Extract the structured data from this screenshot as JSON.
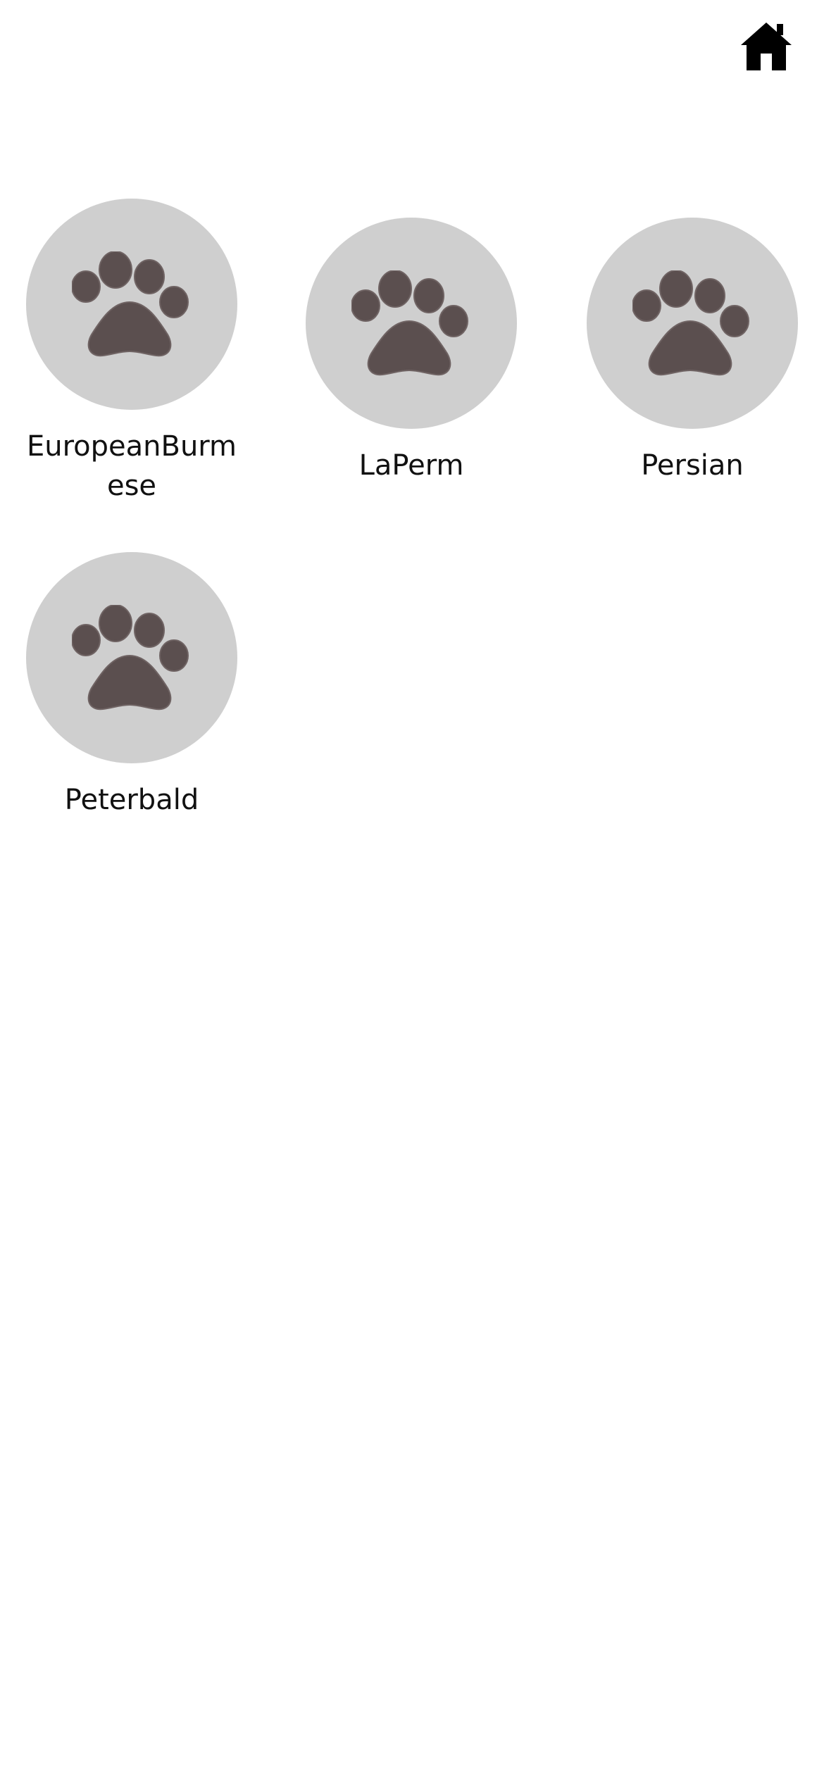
{
  "header": {
    "home_icon": "home-icon"
  },
  "colors": {
    "background": "#ffffff",
    "avatar_background": "#cfcfcf",
    "paw_color": "#5b4f4f",
    "text": "#111111"
  },
  "breeds": [
    {
      "name": "EuropeanBurmese",
      "icon": "paw-icon"
    },
    {
      "name": "LaPerm",
      "icon": "paw-icon"
    },
    {
      "name": "Persian",
      "icon": "paw-icon"
    },
    {
      "name": "Peterbald",
      "icon": "paw-icon"
    }
  ]
}
